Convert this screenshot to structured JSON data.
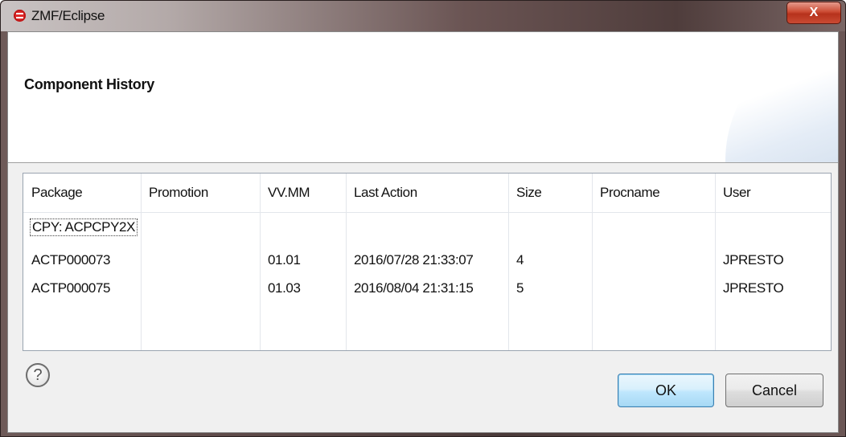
{
  "window": {
    "title": "ZMF/Eclipse",
    "close_label": "X"
  },
  "dialog": {
    "title": "Component History"
  },
  "table": {
    "columns": [
      "Package",
      "Promotion",
      "VV.MM",
      "Last Action",
      "Size",
      "Procname",
      "User"
    ],
    "component_label": "CPY: ACPCPY2X",
    "rows": [
      {
        "package": "ACTP000073",
        "promotion": "",
        "vvmm": "01.01",
        "last_action": "2016/07/28 21:33:07",
        "size": "4",
        "procname": "",
        "user": "JPRESTO"
      },
      {
        "package": "ACTP000075",
        "promotion": "",
        "vvmm": "01.03",
        "last_action": "2016/08/04 21:31:15",
        "size": "5",
        "procname": "",
        "user": "JPRESTO"
      }
    ]
  },
  "buttons": {
    "help_glyph": "?",
    "ok_label": "OK",
    "cancel_label": "Cancel"
  },
  "colors": {
    "close_button": "#c94a33",
    "ok_border": "#3c7fb1",
    "app_icon": "#e02a2a"
  }
}
